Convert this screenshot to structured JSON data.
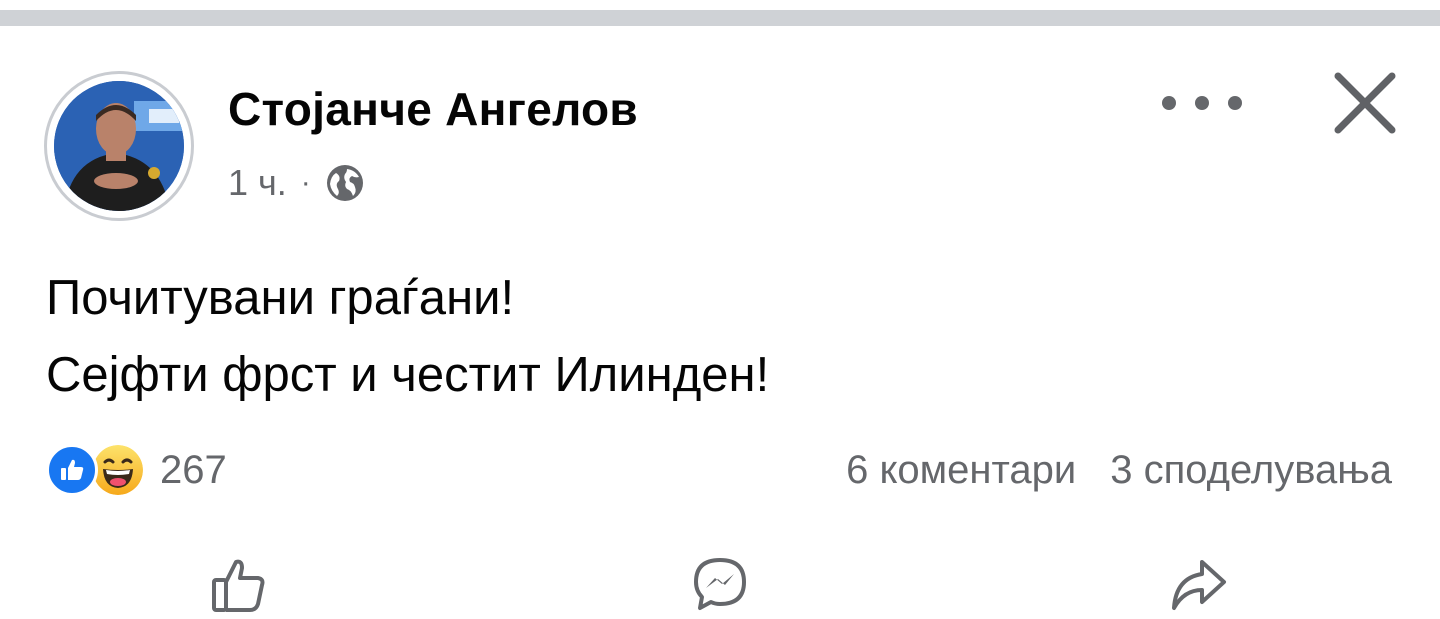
{
  "author": {
    "name": "Стојанче Ангелов",
    "time": "1 ч.",
    "separator": "·",
    "privacy_icon": "globe-icon"
  },
  "header_actions": {
    "more_icon": "more-horizontal-icon",
    "close_icon": "close-icon"
  },
  "post": {
    "lines": [
      "Почитувани граѓани!",
      "Сејфти фрст и честит Илинден!"
    ]
  },
  "reactions": {
    "types": [
      "like-reaction-icon",
      "haha-reaction-icon"
    ],
    "count": "267"
  },
  "stats": {
    "comments": "6 коментари",
    "shares": "3 споделувања"
  },
  "actions": {
    "icons": [
      "like-icon",
      "messenger-icon",
      "share-icon"
    ]
  },
  "colors": {
    "accent_blue": "#1877f2",
    "secondary_text": "#65676b",
    "primary_text": "#050505",
    "divider": "#cfd2d6"
  }
}
